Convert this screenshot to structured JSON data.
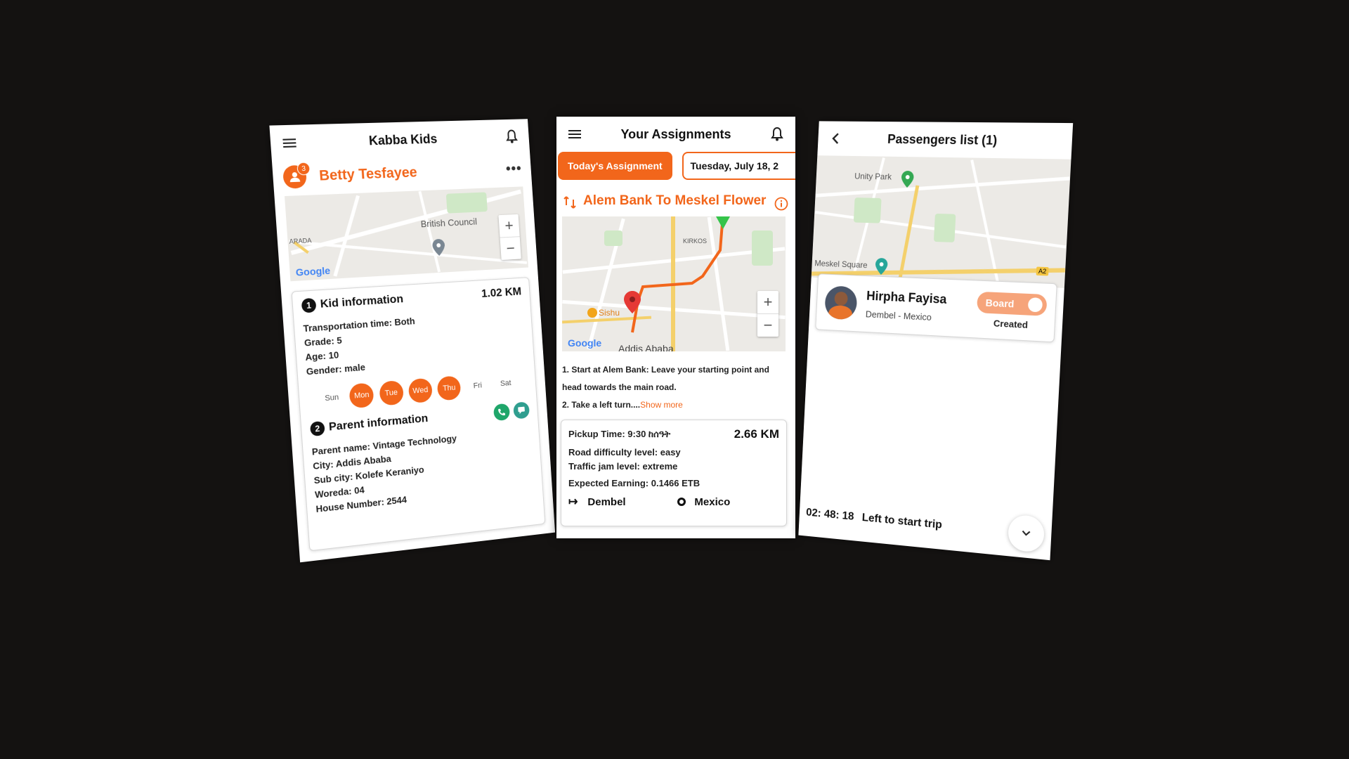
{
  "screen1": {
    "title": "Kabba Kids",
    "kid_name": "Betty Tesfayee",
    "kid_badge": "3",
    "map": {
      "labels": [
        "British Council",
        "ARADA"
      ],
      "brand": "Google",
      "zoom_in": "+",
      "zoom_out": "−"
    },
    "kid_section": {
      "number": "1",
      "heading": "Kid information",
      "distance": "1.02 KM",
      "rows": [
        "Transportation time: Both",
        "Grade: 5",
        "Age: 10",
        "Gender: male"
      ]
    },
    "days": [
      {
        "label": "Sun",
        "active": false
      },
      {
        "label": "Mon",
        "active": true
      },
      {
        "label": "Tue",
        "active": true
      },
      {
        "label": "Wed",
        "active": true
      },
      {
        "label": "Thu",
        "active": true
      },
      {
        "label": "Fri",
        "active": false
      },
      {
        "label": "Sat",
        "active": false
      }
    ],
    "parent_section": {
      "number": "2",
      "heading": "Parent information",
      "rows": [
        "Parent name: Vintage Technology",
        "City: Addis Ababa",
        "Sub city: Kolefe Keraniyo",
        "Woreda: 04",
        "House Number: 2544"
      ]
    }
  },
  "screen2": {
    "title": "Your Assignments",
    "today_button": "Today's Assignment",
    "date_chip": "Tuesday, July 18, 2",
    "route_title": "Alem Bank To Meskel Flower",
    "map": {
      "labels": [
        "KIRKOS",
        "Sishu",
        "Addis Ababa"
      ],
      "brand": "Google",
      "zoom_in": "+",
      "zoom_out": "−"
    },
    "steps": {
      "step1": "1. Start at Alem Bank: Leave your starting point and head towards the main road.",
      "step2": "2. Take a left turn....",
      "show_more": "Show more"
    },
    "info": {
      "pickup": "Pickup Time: 9:30 ከሰዓት",
      "distance": "2.66 KM",
      "difficulty": "Road difficulty level: easy",
      "traffic": "Traffic jam level: extreme",
      "earning": "Expected Earning:  0.1466 ETB",
      "from": "Dembel",
      "to": "Mexico"
    }
  },
  "screen3": {
    "title": "Passengers list (1)",
    "map": {
      "labels": [
        "Unity Park",
        "Meskel Square",
        "A2"
      ]
    },
    "passenger": {
      "name": "Hirpha Fayisa",
      "route": "Dembel - Mexico",
      "toggle_label": "Board",
      "status": "Created"
    },
    "countdown": "02: 48: 18",
    "countdown_label": "Left to start trip"
  },
  "colors": {
    "accent": "#F2661B",
    "background": "#141211",
    "route": "#F2661B",
    "pin_start": "#E53935",
    "pin_end": "#35C44A"
  }
}
